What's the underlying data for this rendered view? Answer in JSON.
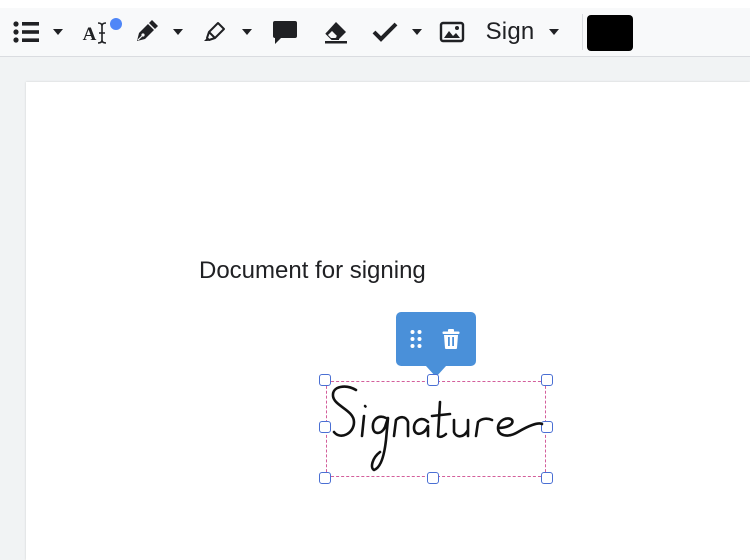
{
  "toolbar": {
    "tools": [
      {
        "name": "list-icon"
      },
      {
        "name": "text-icon",
        "label": "A"
      },
      {
        "name": "pen-icon"
      },
      {
        "name": "highlighter-icon"
      },
      {
        "name": "comment-icon"
      },
      {
        "name": "eraser-icon"
      },
      {
        "name": "checkmark-icon"
      },
      {
        "name": "image-icon"
      }
    ],
    "sign_label": "Sign",
    "current_color": "#000000",
    "badge_color": "#4f86f7"
  },
  "document": {
    "text": "Document for signing"
  },
  "signature": {
    "text": "Signature",
    "selection_color": "#d35f9b",
    "popover_color": "#4a90d9"
  }
}
